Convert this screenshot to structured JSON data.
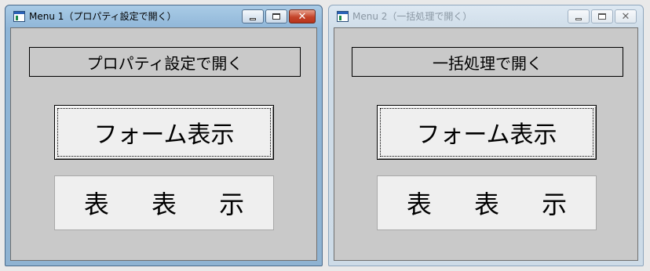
{
  "windows": [
    {
      "title": "Menu 1（プロパティ設定で開く）",
      "active": true,
      "caption_label": "プロパティ設定で開く",
      "form_button": "フォーム表示",
      "table_button": "表 表 示"
    },
    {
      "title": "Menu 2（一括処理で開く）",
      "active": false,
      "caption_label": "一括処理で開く",
      "form_button": "フォーム表示",
      "table_button": "表 表 示"
    }
  ],
  "icons": {
    "app": "form-window-icon",
    "minimize": "minimize-icon",
    "maximize": "maximize-icon",
    "close": "close-icon",
    "close_glyph": "✕"
  },
  "colors": {
    "active_title_bg": "#9fc4e4",
    "inactive_title_bg": "#d6e2ee",
    "close_button": "#c4442a",
    "client_bg": "#c9c9c9",
    "button_bg": "#efefef"
  }
}
